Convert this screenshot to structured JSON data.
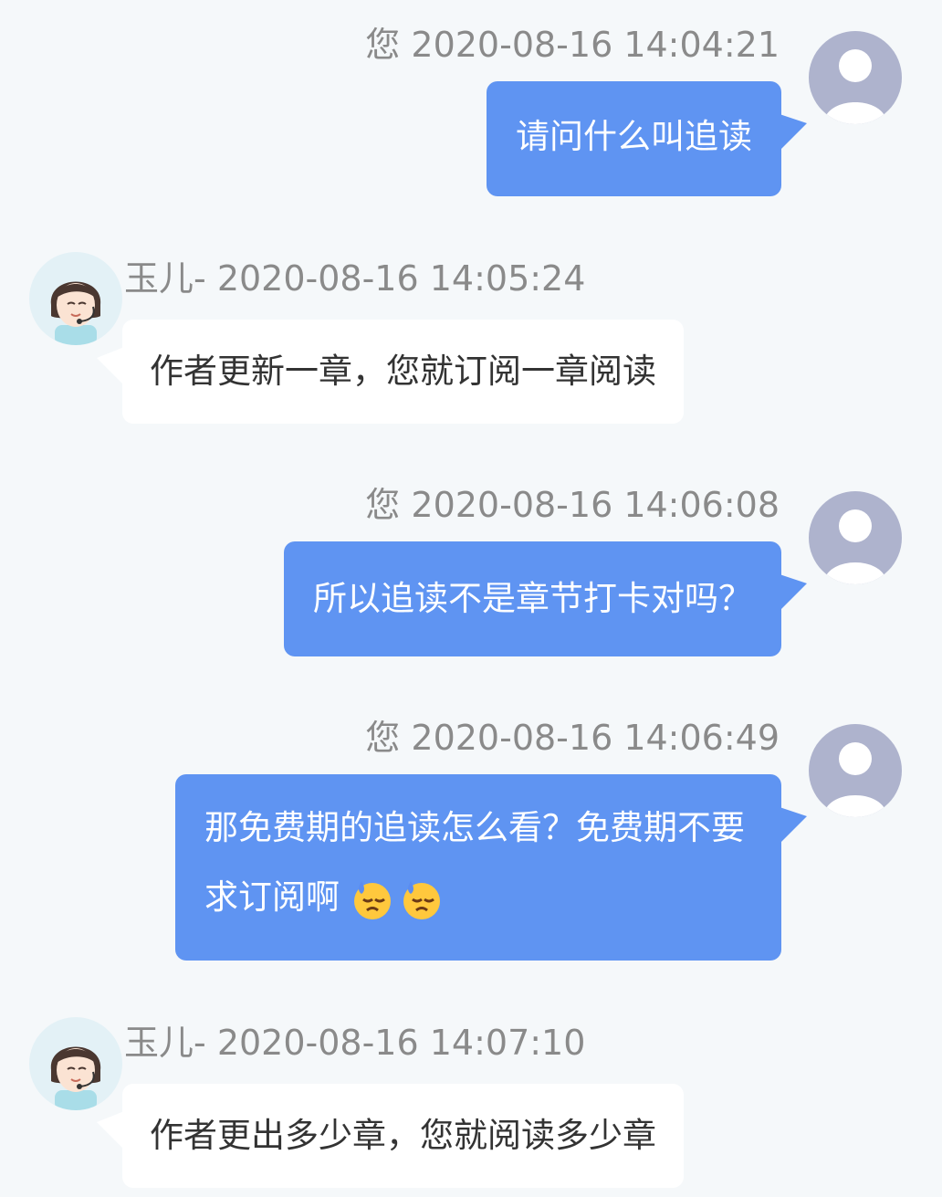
{
  "messages": [
    {
      "sender": "您",
      "time": "2020-08-16 14:04:21",
      "text": "请问什么叫追读"
    },
    {
      "sender": "玉儿-",
      "time": "2020-08-16 14:05:24",
      "text": "作者更新一章，您就订阅一章阅读"
    },
    {
      "sender": "您",
      "time": "2020-08-16 14:06:08",
      "text": "所以追读不是章节打卡对吗？"
    },
    {
      "sender": "您",
      "time": "2020-08-16 14:06:49",
      "text_line1": "那免费期的追读怎么看？免费期不要",
      "text_line2": "求订阅啊",
      "emoji": [
        "downcast-face-with-sweat",
        "downcast-face-with-sweat"
      ]
    },
    {
      "sender": "玉儿-",
      "time": "2020-08-16 14:07:10",
      "text": "作者更出多少章，您就阅读多少章"
    }
  ],
  "colors": {
    "user_bubble": "#5f94f2",
    "agent_bubble": "#ffffff",
    "background": "#f5f8fa"
  }
}
